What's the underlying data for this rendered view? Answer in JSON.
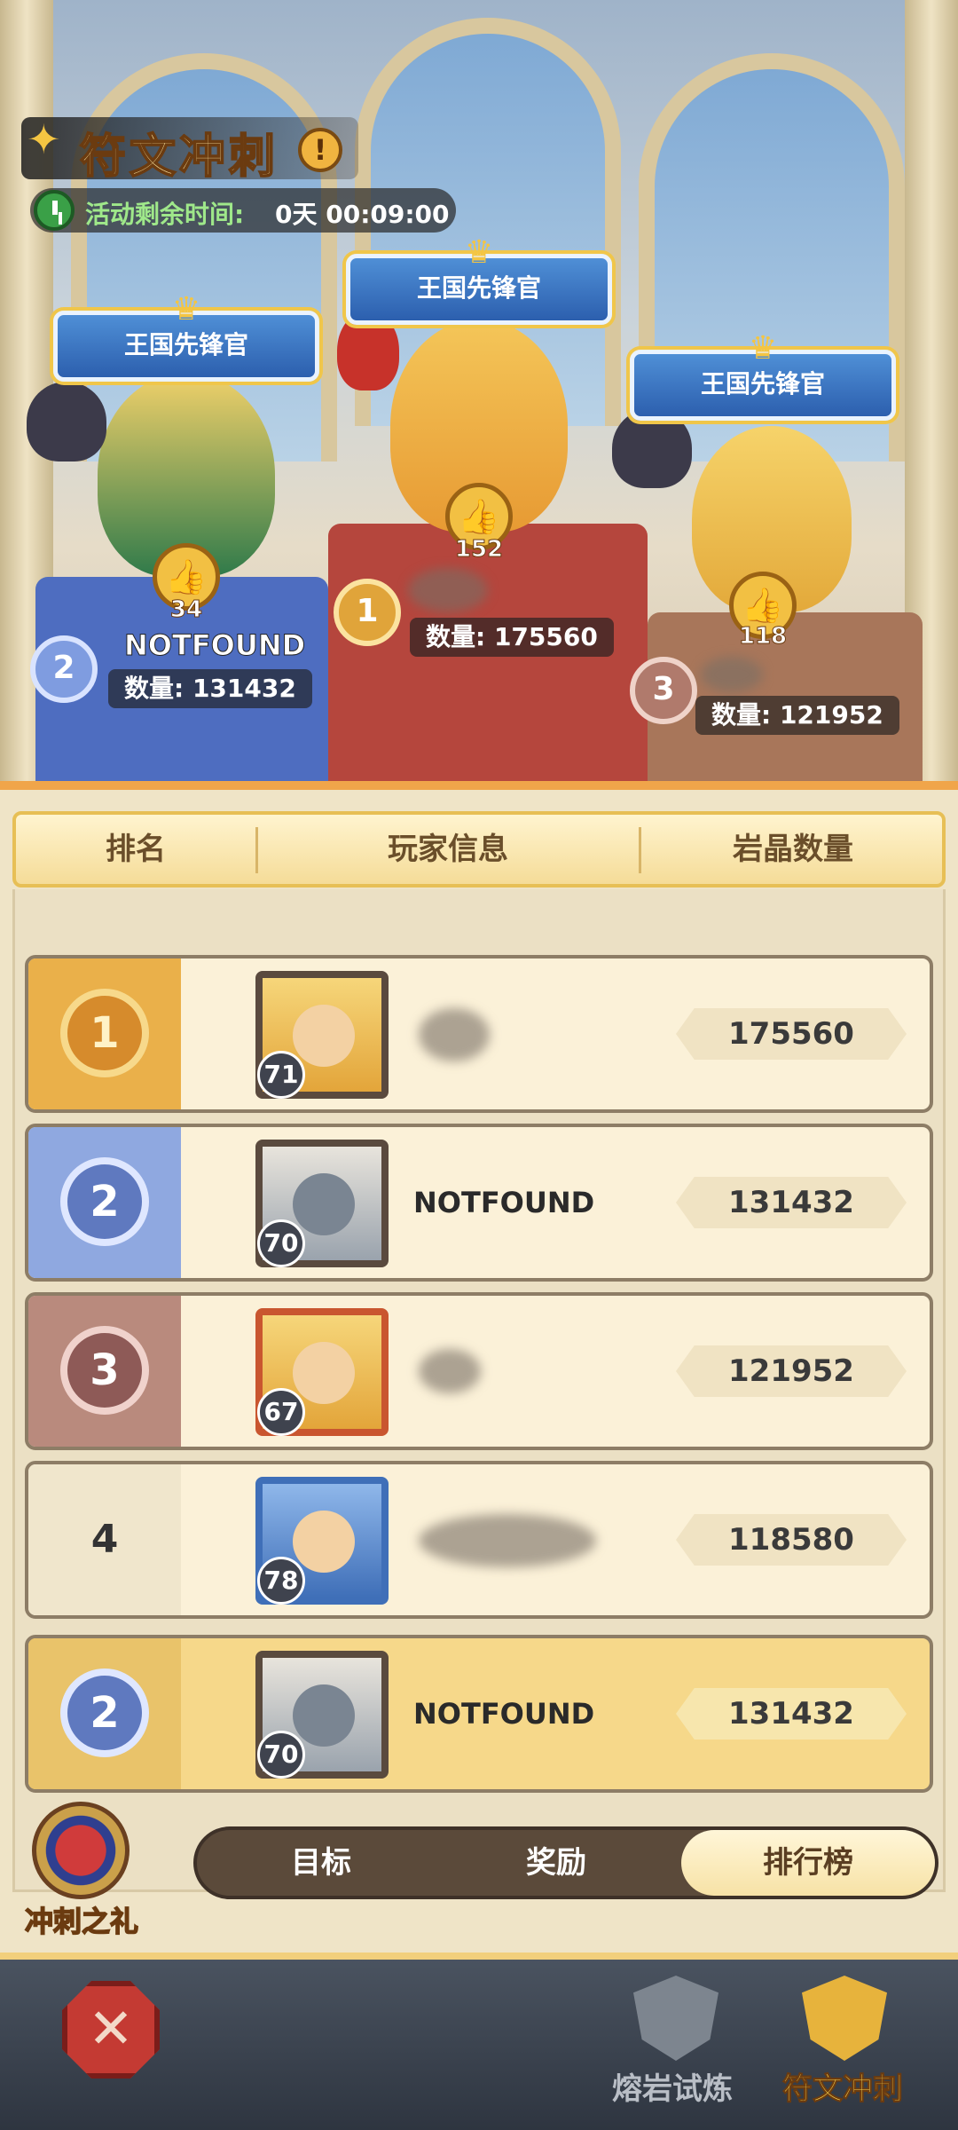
{
  "event": {
    "title": "符文冲刺",
    "info_icon": "exclamation-icon",
    "timer_label": "活动剩余时间:",
    "timer_value": "0天 00:09:00"
  },
  "podium": [
    {
      "rank": "1",
      "banner": "王国先锋官",
      "likes": "152",
      "name": "",
      "qty": "数量: 175560"
    },
    {
      "rank": "2",
      "banner": "王国先锋官",
      "likes": "34",
      "name": "NOTFOUND",
      "qty": "数量: 131432"
    },
    {
      "rank": "3",
      "banner": "王国先锋官",
      "likes": "118",
      "name": "",
      "qty": "数量: 121952"
    }
  ],
  "table": {
    "headers": [
      "排名",
      "玩家信息",
      "岩晶数量"
    ],
    "rows": [
      {
        "rank": "1",
        "level": "71",
        "name": "",
        "score": "175560"
      },
      {
        "rank": "2",
        "level": "70",
        "name": "NOTFOUND",
        "score": "131432"
      },
      {
        "rank": "3",
        "level": "67",
        "name": "",
        "score": "121952"
      },
      {
        "rank": "4",
        "level": "78",
        "name": "",
        "score": "118580"
      }
    ],
    "self": {
      "rank": "2",
      "level": "70",
      "name": "NOTFOUND",
      "score": "131432"
    }
  },
  "gift": {
    "label": "冲刺之礼"
  },
  "tabs": [
    {
      "label": "目标",
      "active": false
    },
    {
      "label": "奖励",
      "active": false
    },
    {
      "label": "排行榜",
      "active": true
    }
  ],
  "nav": {
    "close_icon": "crossed-swords-icon",
    "items": [
      {
        "label": "熔岩试炼",
        "icon": "shield-icon"
      },
      {
        "label": "符文冲刺",
        "icon": "rune-trophy-icon"
      }
    ]
  },
  "colors": {
    "accent": "#f0a54a",
    "gold": "#f4c542",
    "rank1": "#e9a83a",
    "rank2": "#8fa8e0",
    "rank3": "#b98a7d"
  }
}
